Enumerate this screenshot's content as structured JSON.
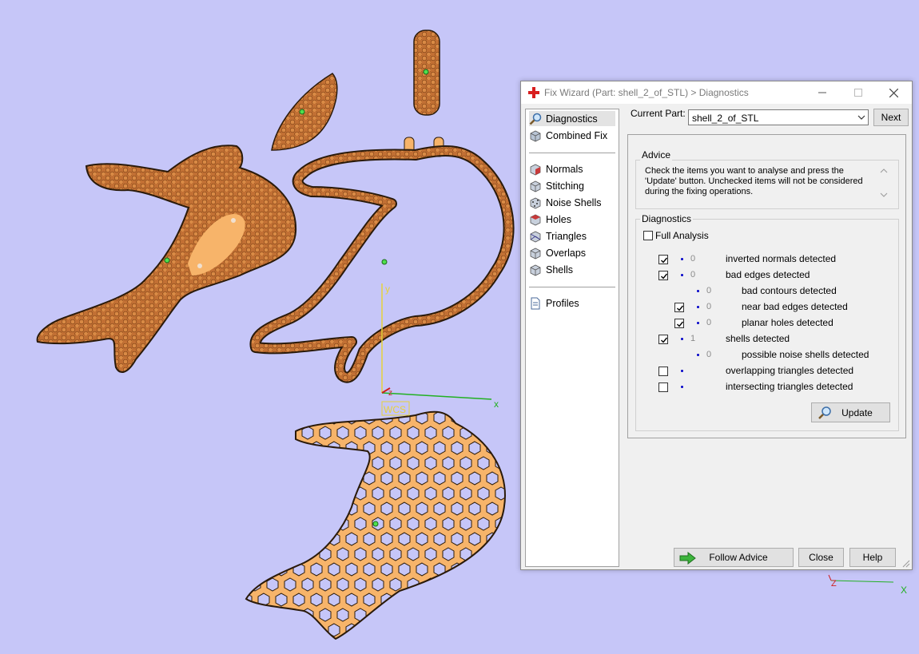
{
  "window": {
    "title": "Fix Wizard (Part: shell_2_of_STL) > Diagnostics",
    "icon": "red-cross-icon",
    "controls": [
      "minimize-icon",
      "maximize-icon",
      "close-icon"
    ]
  },
  "nav": {
    "top_items": [
      {
        "label": "Diagnostics",
        "icon": "magnifier-icon",
        "selected": true
      },
      {
        "label": "Combined Fix",
        "icon": "cube-icon"
      }
    ],
    "fix_items": [
      {
        "label": "Normals",
        "icon": "normals-cube-icon"
      },
      {
        "label": "Stitching",
        "icon": "stitching-cube-icon"
      },
      {
        "label": "Noise Shells",
        "icon": "noise-shells-icon"
      },
      {
        "label": "Holes",
        "icon": "holes-cube-icon"
      },
      {
        "label": "Triangles",
        "icon": "triangles-cube-icon"
      },
      {
        "label": "Overlaps",
        "icon": "overlaps-cube-icon"
      },
      {
        "label": "Shells",
        "icon": "shells-cube-icon"
      }
    ],
    "profiles": {
      "label": "Profiles",
      "icon": "document-icon"
    }
  },
  "current_part": {
    "label": "Current Part:",
    "value": "shell_2_of_STL",
    "next_label": "Next"
  },
  "advice": {
    "title": "Advice",
    "text": "Check the items you want to analyse and press the 'Update' button. Unchecked items will not be considered during the fixing operations."
  },
  "diagnostics": {
    "title": "Diagnostics",
    "full_analysis": {
      "label": "Full Analysis",
      "checked": false
    },
    "rows": [
      {
        "label": "inverted normals detected",
        "count": "0",
        "checked": true,
        "has_checkbox": true,
        "indent": 0
      },
      {
        "label": "bad edges detected",
        "count": "0",
        "checked": true,
        "has_checkbox": true,
        "indent": 0
      },
      {
        "label": "bad contours detected",
        "count": "0",
        "checked": false,
        "has_checkbox": false,
        "indent": 1
      },
      {
        "label": "near bad edges detected",
        "count": "0",
        "checked": true,
        "has_checkbox": true,
        "indent": 1
      },
      {
        "label": "planar holes detected",
        "count": "0",
        "checked": true,
        "has_checkbox": true,
        "indent": 1
      },
      {
        "label": "shells detected",
        "count": "1",
        "checked": true,
        "has_checkbox": true,
        "indent": 0
      },
      {
        "label": "possible noise shells detected",
        "count": "0",
        "checked": false,
        "has_checkbox": false,
        "indent": 1
      },
      {
        "label": "overlapping triangles detected",
        "count": "",
        "checked": false,
        "has_checkbox": true,
        "indent": 0
      },
      {
        "label": "intersecting triangles detected",
        "count": "",
        "checked": false,
        "has_checkbox": true,
        "indent": 0
      }
    ],
    "update_label": "Update"
  },
  "footer": {
    "follow_advice_label": "Follow Advice",
    "close_label": "Close",
    "help_label": "Help"
  },
  "viewport": {
    "axis_x_label": "x",
    "axis_y_label": "y",
    "axis_z_label": "z",
    "wcs_label": "WCS",
    "mini_z_label": "Z",
    "mini_x_label": "X",
    "colors": {
      "background": "#c6c6f8",
      "mesh_light": "#f7b46a",
      "mesh_dark": "#b5652c",
      "outline": "#2a1a0a",
      "axis_x": "#22b022",
      "axis_y": "#e6d23a",
      "axis_z": "#d02020"
    }
  }
}
